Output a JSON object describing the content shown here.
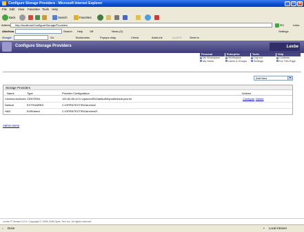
{
  "window": {
    "title": "Configure Storage Providers - Microsoft Internet Explorer"
  },
  "menu": [
    "File",
    "Edit",
    "View",
    "Favorites",
    "Tools",
    "Help"
  ],
  "toolbar": {
    "back": "Back",
    "search": "Search",
    "favorites": "Favorites",
    "go": "Go",
    "links": "Links"
  },
  "address": {
    "label": "Address",
    "url": "http://localhost/ConfigureStorage/Providers"
  },
  "toolbar2": {
    "brand": "AltaVista",
    "search_label": "Search",
    "help": "Help",
    "off": "Off",
    "bookmarks": "Bookmarks",
    "popups": "Popups okay",
    "check": "Check",
    "autolink": "AutoLink",
    "autofill": "AutoFill",
    "sendto": "Send to",
    "news": "News (0)",
    "settings": "Settings"
  },
  "toolbar3": {
    "brand": "Google",
    "go": "Go"
  },
  "page": {
    "title": "Configure Storage Providers",
    "brand": "Lexbe"
  },
  "nav": [
    {
      "heading": "Personal",
      "links": [
        "My Workspace",
        "My Home"
      ]
    },
    {
      "heading": "Enterprise",
      "links": [
        "Workspace",
        "Users & Groups"
      ]
    },
    {
      "heading": "Tools",
      "links": [
        "Log out",
        "Settings"
      ]
    },
    {
      "heading": "Help",
      "links": [
        "Contents",
        "For This Page"
      ]
    }
  ],
  "add_select": {
    "value": "Add New"
  },
  "panel": {
    "title": "Storage Providers",
    "columns": {
      "name": "Name",
      "type": "Type",
      "config": "Provider Configuration",
      "actions": "Actions"
    },
    "rows": [
      {
        "name": "Centera Archives",
        "type": "CENTERA",
        "config": "192.62.85.11?c:\\openext\\RU\\default\\rhprofile\\blob.pea.txt",
        "configure": "Configure",
        "delete": "Delete"
      },
      {
        "name": "Default",
        "type": "EXTSHARED",
        "config": "C:\\OPENTEXT\\RU\\Archive\\",
        "configure": "",
        "delete": ""
      },
      {
        "name": "HAD",
        "type": "ExtShared",
        "config": "C:\\OPENTEXT\\RU\\ArchiveZ\\",
        "configure": "",
        "delete": ""
      }
    ]
  },
  "admin_home": "Admin Home",
  "footer": "Lexbe ® Version 5.0.0. Copyright © 1998-2008 Open Text Inc. All rights reserved.",
  "status": {
    "left": "Done",
    "right": "Local intranet"
  },
  "colors": {
    "header": "#474685",
    "titlebar": "#0a4fd0",
    "link": "#0000cc"
  }
}
